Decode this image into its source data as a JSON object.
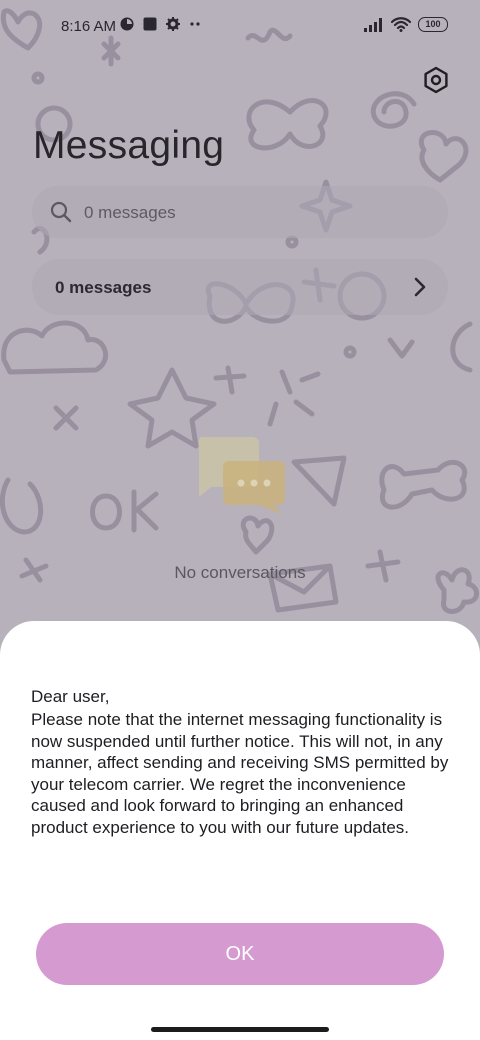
{
  "status_bar": {
    "time": "8:16 AM",
    "battery": "100",
    "left_icons": [
      "data-saver-icon",
      "notification-square-icon",
      "gear-icon",
      "more-dots-icon"
    ],
    "right_icons": [
      "signal-icon",
      "wifi-icon",
      "battery-icon"
    ]
  },
  "header": {
    "title": "Messaging",
    "settings_icon": "gear-hexagon-icon"
  },
  "search": {
    "placeholder": "0 messages"
  },
  "messages_row": {
    "label": "0 messages"
  },
  "empty_state": {
    "text": "No conversations",
    "icon": "chat-bubbles-icon",
    "colors": {
      "bubble_back": "#c9c3a9",
      "bubble_front": "#c9b27f"
    }
  },
  "dialog": {
    "greeting": "Dear user,",
    "body": "Please note that the internet messaging functionality is now suspended until further notice. This will not, in any manner, affect sending and receiving SMS permitted by your telecom carrier. We regret the inconvenience caused and look forward to bringing an enhanced product experience to you with our future updates.",
    "ok_label": "OK"
  },
  "colors": {
    "overlay_background": "#b7b1bb",
    "doodle_stroke": "#8e8696",
    "ok_button": "#d59bd0",
    "dialog_background": "#ffffff"
  }
}
